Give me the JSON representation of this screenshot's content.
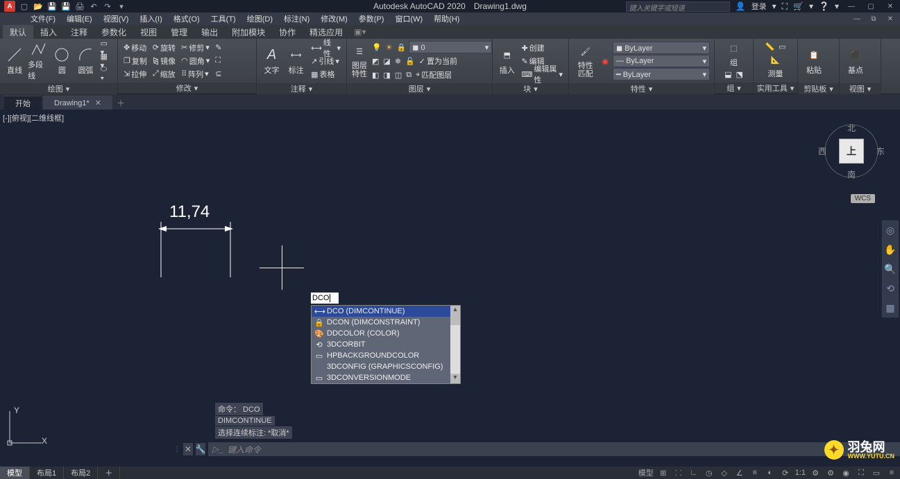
{
  "title": {
    "app": "Autodesk AutoCAD 2020",
    "file": "Drawing1.dwg"
  },
  "search": {
    "placeholder": "键入关键字或短语",
    "login": "登录"
  },
  "menubar": [
    "文件(F)",
    "编辑(E)",
    "视图(V)",
    "插入(I)",
    "格式(O)",
    "工具(T)",
    "绘图(D)",
    "标注(N)",
    "修改(M)",
    "参数(P)",
    "窗口(W)",
    "帮助(H)"
  ],
  "ribbon_tabs": [
    "默认",
    "插入",
    "注释",
    "参数化",
    "视图",
    "管理",
    "输出",
    "附加模块",
    "协作",
    "精选应用"
  ],
  "panels": {
    "draw": {
      "title": "绘图",
      "line": "直线",
      "polyline": "多段线",
      "circle": "圆",
      "arc": "圆弧"
    },
    "modify": {
      "title": "修改",
      "move": "移动",
      "rotate": "旋转",
      "trim": "修剪",
      "copy": "复制",
      "mirror": "镜像",
      "fillet": "圆角",
      "stretch": "拉伸",
      "scale": "缩放",
      "array": "阵列"
    },
    "annot": {
      "title": "注释",
      "text": "文字",
      "dim": "标注",
      "leader": "引线",
      "table": "表格",
      "linear": "线性"
    },
    "layer": {
      "title": "图层",
      "props": "图层\n特性",
      "current": "0",
      "setcur": "置为当前",
      "match": "匹配图层"
    },
    "block": {
      "title": "块",
      "insert": "插入",
      "create": "创建",
      "edit": "编辑",
      "editattr": "编辑属性"
    },
    "props": {
      "title": "特性",
      "match": "特性\n匹配",
      "bylayer": "ByLayer"
    },
    "group": {
      "title": "组",
      "label": "组"
    },
    "util": {
      "title": "实用工具",
      "measure": "测量"
    },
    "clip": {
      "title": "剪贴板",
      "paste": "粘贴"
    },
    "view": {
      "title": "视图",
      "base": "基点"
    }
  },
  "file_tabs": {
    "start": "开始",
    "drawing": "Drawing1*"
  },
  "viewport_label": "[-][俯视][二维线框]",
  "viewcube": {
    "top": "上",
    "n": "北",
    "s": "南",
    "e": "东",
    "w": "西",
    "wcs": "WCS"
  },
  "dimension": {
    "value": "11,74"
  },
  "command_input": "DCO",
  "autocomplete": [
    {
      "icon": "dim",
      "text": "DCO (DIMCONTINUE)",
      "sel": true
    },
    {
      "icon": "lock",
      "text": "DCON (DIMCONSTRAINT)"
    },
    {
      "icon": "color",
      "text": "DDCOLOR (COLOR)"
    },
    {
      "icon": "orbit",
      "text": "3DCORBIT"
    },
    {
      "icon": "rect",
      "text": "HPBACKGROUNDCOLOR"
    },
    {
      "icon": "",
      "text": "3DCONFIG (GRAPHICSCONFIG)"
    },
    {
      "icon": "rect",
      "text": "3DCONVERSIONMODE"
    }
  ],
  "cmd_history": [
    "命令： DCO",
    "DIMCONTINUE",
    "选择连续标注: *取消*"
  ],
  "cmd_prompt": "键入命令",
  "model_tabs": [
    "模型",
    "布局1",
    "布局2"
  ],
  "status_right": {
    "scale": "1:1",
    "model": "模型"
  },
  "ucs": {
    "x": "X",
    "y": "Y"
  },
  "watermark": {
    "name": "羽兔网",
    "url": "WWW.YUTU.CN"
  }
}
